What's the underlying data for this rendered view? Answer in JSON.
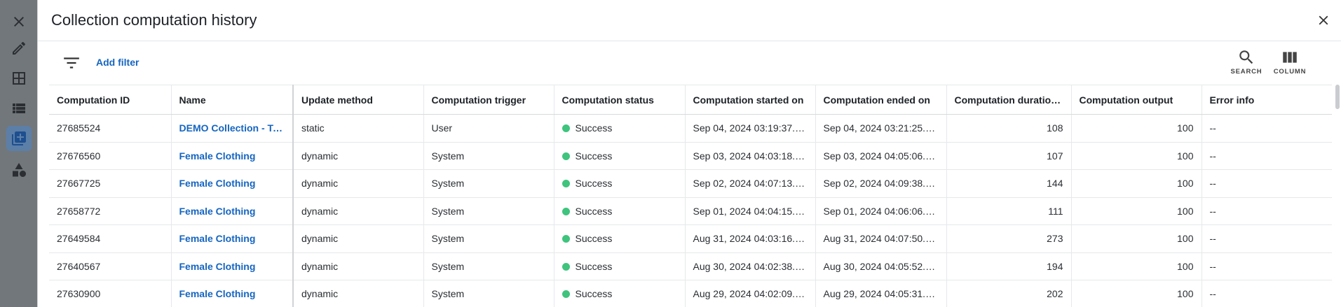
{
  "rail": {
    "items": [
      {
        "icon": "close-icon"
      },
      {
        "icon": "pencil-icon"
      },
      {
        "icon": "table-icon"
      },
      {
        "icon": "list-icon"
      },
      {
        "icon": "library-add-icon",
        "active": true
      },
      {
        "icon": "shapes-icon"
      }
    ]
  },
  "header": {
    "title": "Collection computation history"
  },
  "toolbar": {
    "add_filter": "Add filter",
    "search_label": "SEARCH",
    "column_label": "COLUMN"
  },
  "table": {
    "columns": [
      "Computation ID",
      "Name",
      "Update method",
      "Computation trigger",
      "Computation status",
      "Computation started on",
      "Computation ended on",
      "Computation duration ...",
      "Computation output",
      "Error info"
    ],
    "rows": [
      {
        "id": "27685524",
        "name": "DEMO Collection - Tops",
        "method": "static",
        "trigger": "User",
        "status": "Success",
        "started": "Sep 04, 2024 03:19:37.0...",
        "ended": "Sep 04, 2024 03:21:25.0...",
        "duration": "108",
        "output": "100",
        "error": "--"
      },
      {
        "id": "27676560",
        "name": "Female Clothing",
        "method": "dynamic",
        "trigger": "System",
        "status": "Success",
        "started": "Sep 03, 2024 04:03:18.0...",
        "ended": "Sep 03, 2024 04:05:06.0...",
        "duration": "107",
        "output": "100",
        "error": "--"
      },
      {
        "id": "27667725",
        "name": "Female Clothing",
        "method": "dynamic",
        "trigger": "System",
        "status": "Success",
        "started": "Sep 02, 2024 04:07:13.0...",
        "ended": "Sep 02, 2024 04:09:38.0...",
        "duration": "144",
        "output": "100",
        "error": "--"
      },
      {
        "id": "27658772",
        "name": "Female Clothing",
        "method": "dynamic",
        "trigger": "System",
        "status": "Success",
        "started": "Sep 01, 2024 04:04:15.0...",
        "ended": "Sep 01, 2024 04:06:06.0...",
        "duration": "111",
        "output": "100",
        "error": "--"
      },
      {
        "id": "27649584",
        "name": "Female Clothing",
        "method": "dynamic",
        "trigger": "System",
        "status": "Success",
        "started": "Aug 31, 2024 04:03:16.0...",
        "ended": "Aug 31, 2024 04:07:50.0...",
        "duration": "273",
        "output": "100",
        "error": "--"
      },
      {
        "id": "27640567",
        "name": "Female Clothing",
        "method": "dynamic",
        "trigger": "System",
        "status": "Success",
        "started": "Aug 30, 2024 04:02:38.0...",
        "ended": "Aug 30, 2024 04:05:52.0...",
        "duration": "194",
        "output": "100",
        "error": "--"
      },
      {
        "id": "27630900",
        "name": "Female Clothing",
        "method": "dynamic",
        "trigger": "System",
        "status": "Success",
        "started": "Aug 29, 2024 04:02:09.0...",
        "ended": "Aug 29, 2024 04:05:31.0...",
        "duration": "202",
        "output": "100",
        "error": "--"
      }
    ]
  },
  "colors": {
    "link": "#1565c0",
    "success": "#3ec47d",
    "rail_bg": "#72777c"
  }
}
